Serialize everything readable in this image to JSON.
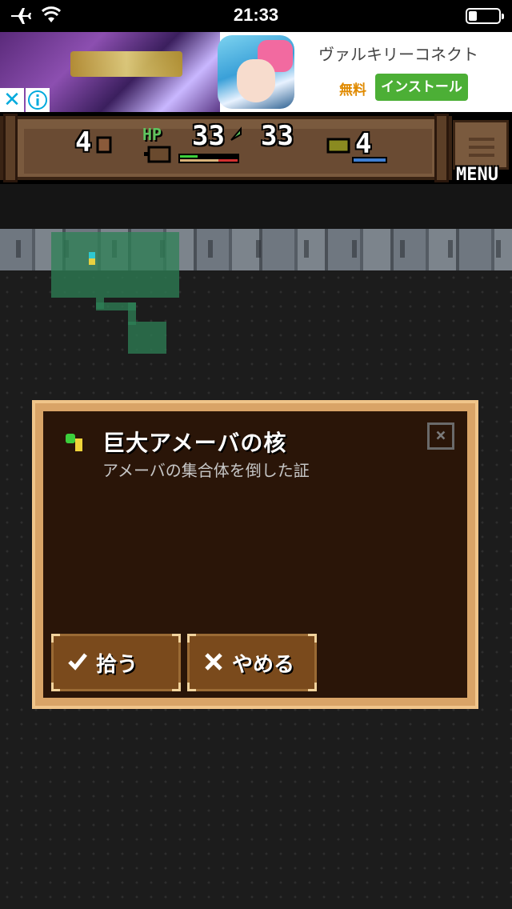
{
  "status_bar": {
    "time": "21:33"
  },
  "ad": {
    "title": "ヴァルキリーコネクト",
    "free_label": "無料",
    "install_label": "インストール",
    "close_label": "✕"
  },
  "hud": {
    "floor": "4",
    "hp_label": "HP",
    "hp_current": "33",
    "hp_max": "33",
    "keys": "4",
    "menu_label": "MENU",
    "hp_fraction": 1.0
  },
  "dialog": {
    "item_name": "巨大アメーバの核",
    "item_description": "アメーバの集合体を倒した証",
    "close_symbol": "×",
    "pickup_label": "拾う",
    "cancel_label": "やめる"
  },
  "colors": {
    "hp_green": "#3ccf3c",
    "hp_red": "#d23030",
    "room_green": "#2e8056",
    "dialog_frame": "#d9a467",
    "dialog_bg": "#2a1508",
    "install_green": "#4caf36"
  },
  "icons": [
    "airplane-icon",
    "wifi-icon",
    "battery-icon",
    "ad-info-icon",
    "stairs-icon",
    "hp-potion-icon",
    "key-icon",
    "menu-list-icon",
    "item-core-icon",
    "check-icon",
    "cross-icon"
  ]
}
